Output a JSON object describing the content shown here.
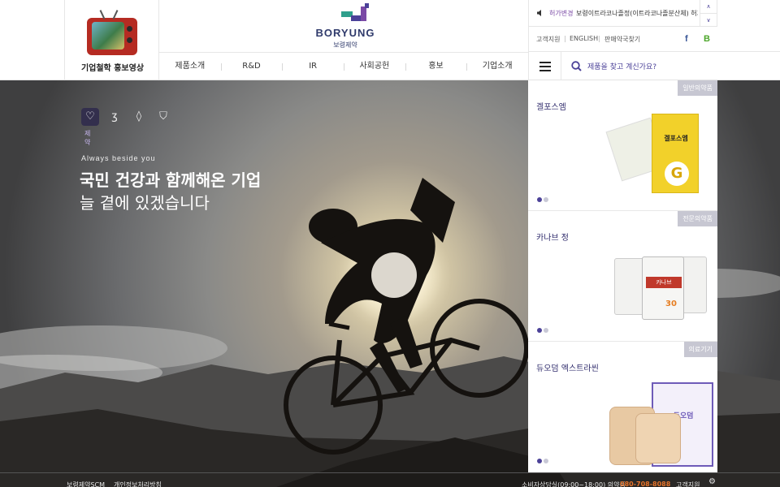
{
  "header": {
    "promo_label": "기업철학 홍보영상",
    "logo_name": "BORYUNG",
    "logo_kr": "보령제약",
    "nav": [
      "제품소개",
      "R&D",
      "IR",
      "사회공헌",
      "홍보",
      "기업소개"
    ]
  },
  "util": {
    "notice_tag": "허가변경",
    "notice_text": "보령이트라코나졸정(이트라코나졸분산체) 허가",
    "links": [
      "고객지원",
      "ENGLISH",
      "판매약국찾기"
    ],
    "facebook_icon": "f",
    "blog_icon": "B",
    "search_placeholder": "제품을 찾고 계신가요?"
  },
  "hero": {
    "categories": [
      "heart-icon",
      "leaf-icon",
      "drop-icon",
      "shield-icon"
    ],
    "active_label": "제약",
    "tagline": "Always beside you",
    "headline1": "국민 건강과 함께해온 기업",
    "headline2": "늘 곁에 있겠습니다"
  },
  "products": [
    {
      "badge": "일반의약품",
      "name": "겔포스엠"
    },
    {
      "badge": "전문의약품",
      "name": "카나브 정"
    },
    {
      "badge": "의료기기",
      "name": "듀오덤 엑스트라씬"
    }
  ],
  "product_images": {
    "gel_box": "겔포스엠",
    "gel_letter": "G",
    "kanarb": "카나브",
    "kanarb_dose": "30",
    "duoderm": "듀오덤"
  },
  "footer": {
    "scm": "보령제약SCM",
    "privacy": "개인정보처리방침",
    "consult": "소비자상담실(09:00~18:00) 의약품",
    "phone": "080-708-8088",
    "support": "고객지원"
  },
  "colors": {
    "brand_purple": "#4b4198",
    "brand_teal": "#2f9f8c",
    "accent_orange": "#e8742a"
  }
}
